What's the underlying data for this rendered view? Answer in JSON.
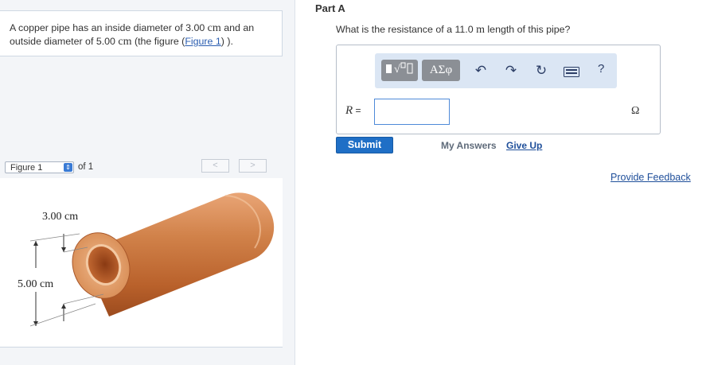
{
  "problem": {
    "text_before": "A copper pipe has an inside diameter of 3.00 ",
    "unit1": "cm",
    "text_mid": " and an outside diameter of 5.00 ",
    "unit2": "cm",
    "text_after": " (the figure (",
    "figure_link": "Figure 1",
    "text_end": ") )."
  },
  "figure": {
    "select_value": "Figure 1",
    "of_label": "of 1",
    "prev_label": "<",
    "next_label": ">",
    "inner_diameter_label": "3.00 cm",
    "outer_diameter_label": "5.00 cm"
  },
  "part": {
    "title": "Part A",
    "question_before": "What is the resistance of a 11.0 ",
    "question_unit": "m",
    "question_after": " length of this pipe?"
  },
  "toolbar": {
    "template_icon": "fraction-sqrt-template-icon",
    "greek_label": "ΑΣφ",
    "undo_icon": "undo-icon",
    "redo_icon": "redo-icon",
    "reset_icon": "reset-icon",
    "keyboard_icon": "keyboard-icon",
    "help_label": "?"
  },
  "answer": {
    "variable": "R",
    "equals": " =",
    "value": "",
    "unit": "Ω"
  },
  "actions": {
    "submit": "Submit",
    "my_answers": "My Answers",
    "give_up": "Give Up",
    "provide_feedback": "Provide Feedback"
  },
  "colors": {
    "accent": "#1f6fc6",
    "link": "#1f4f9a",
    "copper": "#c9733a"
  }
}
